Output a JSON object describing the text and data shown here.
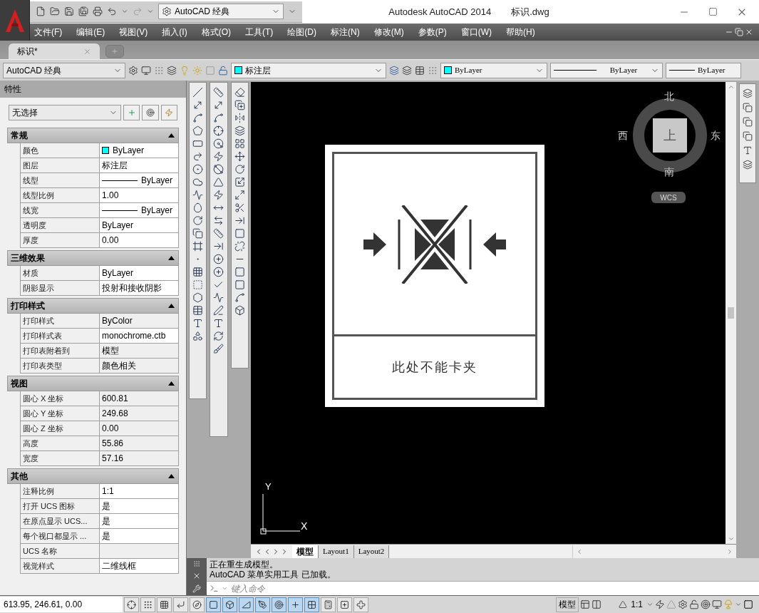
{
  "title_bar": {
    "workspace": "AutoCAD 经典",
    "title": "Autodesk AutoCAD 2014",
    "filename": "标识.dwg"
  },
  "menu": [
    "文件(F)",
    "编辑(E)",
    "视图(V)",
    "插入(I)",
    "格式(O)",
    "工具(T)",
    "绘图(D)",
    "标注(N)",
    "修改(M)",
    "参数(P)",
    "窗口(W)",
    "帮助(H)"
  ],
  "doc_tabs": [
    {
      "label": "标识*",
      "selected": true
    }
  ],
  "toolbar": {
    "workspace": "AutoCAD 经典",
    "layer": {
      "name": "标注层",
      "color": "#00ffff"
    },
    "color_control": {
      "value": "ByLayer",
      "color": "#00ffff"
    },
    "linetype": "ByLayer",
    "lineweight": "ByLayer"
  },
  "properties": {
    "title": "特性",
    "selection": "无选择",
    "sections": [
      {
        "title": "常规",
        "expanded": true,
        "rows": [
          {
            "label": "颜色",
            "value": "ByLayer",
            "color": "#00ffff",
            "readonly": false
          },
          {
            "label": "图层",
            "value": "标注层",
            "readonly": false
          },
          {
            "label": "线型",
            "value": "ByLayer",
            "kind": "line",
            "readonly": false
          },
          {
            "label": "线型比例",
            "value": "1.00",
            "readonly": false
          },
          {
            "label": "线宽",
            "value": "ByLayer",
            "kind": "line",
            "readonly": false
          },
          {
            "label": "透明度",
            "value": "ByLayer",
            "readonly": false
          },
          {
            "label": "厚度",
            "value": "0.00",
            "readonly": false
          }
        ]
      },
      {
        "title": "三维效果",
        "expanded": true,
        "rows": [
          {
            "label": "材质",
            "value": "ByLayer",
            "readonly": false
          },
          {
            "label": "阴影显示",
            "value": "投射和接收阴影",
            "readonly": false
          }
        ]
      },
      {
        "title": "打印样式",
        "expanded": true,
        "rows": [
          {
            "label": "打印样式",
            "value": "ByColor",
            "readonly": true
          },
          {
            "label": "打印样式表",
            "value": "monochrome.ctb",
            "readonly": false
          },
          {
            "label": "打印表附着到",
            "value": "模型",
            "readonly": true
          },
          {
            "label": "打印表类型",
            "value": "颜色相关",
            "readonly": true
          }
        ]
      },
      {
        "title": "视图",
        "expanded": true,
        "rows": [
          {
            "label": "圆心 X 坐标",
            "value": "600.81",
            "readonly": true
          },
          {
            "label": "圆心 Y 坐标",
            "value": "249.68",
            "readonly": true
          },
          {
            "label": "圆心 Z 坐标",
            "value": "0.00",
            "readonly": true
          },
          {
            "label": "高度",
            "value": "55.86",
            "readonly": true
          },
          {
            "label": "宽度",
            "value": "57.16",
            "readonly": true
          }
        ]
      },
      {
        "title": "其他",
        "expanded": true,
        "rows": [
          {
            "label": "注释比例",
            "value": "1:1",
            "readonly": false
          },
          {
            "label": "打开 UCS 图标",
            "value": "是",
            "readonly": false
          },
          {
            "label": "在原点显示 UCS...",
            "value": "是",
            "readonly": false
          },
          {
            "label": "每个视口都显示 ...",
            "value": "是",
            "readonly": false
          },
          {
            "label": "UCS 名称",
            "readonly": true
          },
          {
            "label": "视觉样式",
            "value": "二维线框",
            "readonly": false
          }
        ]
      }
    ]
  },
  "canvas": {
    "sign_caption": "此处不能卡夹",
    "viewcube": {
      "north": "北",
      "west": "西",
      "east": "东",
      "south": "南",
      "top": "上",
      "coordinate_system": "WCS"
    },
    "ucs_labels": {
      "y": "Y",
      "x": "X"
    }
  },
  "layout_tabs": [
    {
      "label": "模型",
      "selected": true
    },
    {
      "label": "Layout1",
      "selected": false
    },
    {
      "label": "Layout2",
      "selected": false
    }
  ],
  "command": {
    "history": [
      "正在重生成模型。",
      "AutoCAD 菜单实用工具 已加载。"
    ],
    "placeholder": "键入命令"
  },
  "status_bar": {
    "coordinates": "613.95, 246.61, 0.00",
    "toggles": [
      {
        "on": false
      },
      {
        "on": false
      },
      {
        "on": false
      },
      {
        "on": false
      },
      {
        "on": false
      },
      {
        "on": true
      },
      {
        "on": true
      },
      {
        "on": true
      },
      {
        "on": true
      },
      {
        "on": true
      },
      {
        "on": true
      },
      {
        "on": true
      },
      {
        "on": false
      },
      {
        "on": false
      },
      {
        "on": false
      }
    ],
    "space": "模型",
    "scale": "1:1"
  }
}
